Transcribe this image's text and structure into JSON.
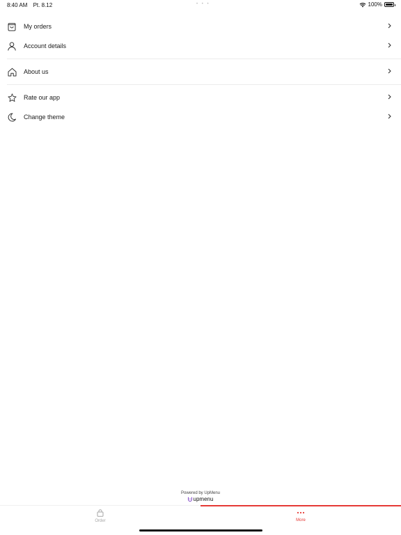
{
  "status": {
    "time": "8:40 AM",
    "date": "Pt. 8.12",
    "battery": "100%",
    "battery_level": 1.0
  },
  "menu": {
    "items": [
      {
        "label": "My orders",
        "icon": "bag-icon"
      },
      {
        "label": "Account details",
        "icon": "person-icon"
      },
      {
        "label": "About us",
        "icon": "home-icon"
      },
      {
        "label": "Rate our app",
        "icon": "star-icon"
      },
      {
        "label": "Change theme",
        "icon": "moon-icon"
      }
    ]
  },
  "footer": {
    "powered_by": "Powered by UpMenu",
    "brand": "upmenu"
  },
  "tabs": [
    {
      "label": "Order",
      "icon": "lock-bag-icon",
      "active": false
    },
    {
      "label": "More",
      "icon": "more-dots-icon",
      "active": true
    }
  ],
  "colors": {
    "accent": "#e53935",
    "inactive": "#a6a6a6",
    "text": "#1a1a1a"
  }
}
